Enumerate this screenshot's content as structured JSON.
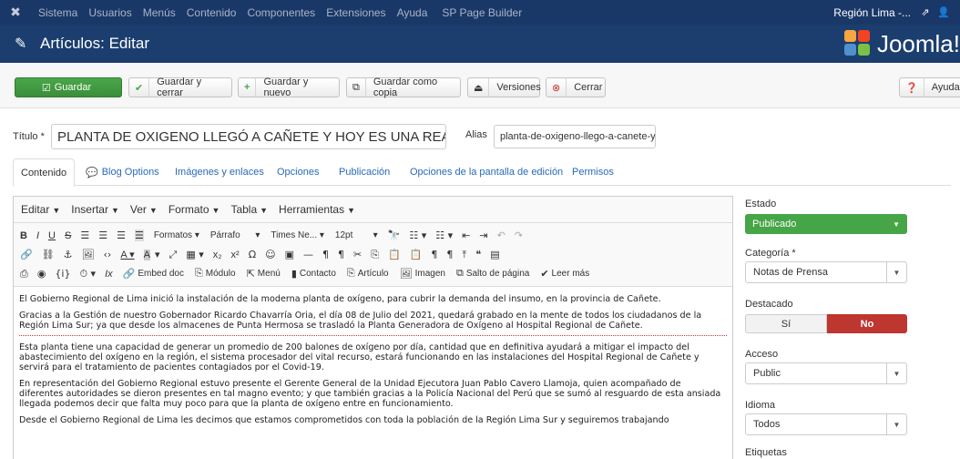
{
  "topnav": {
    "menu": [
      "Sistema",
      "Usuarios",
      "Menús",
      "Contenido",
      "Componentes",
      "Extensiones",
      "Ayuda",
      "SP Page Builder"
    ],
    "site_label": "Región Lima -...",
    "external_icon": "external-link-icon",
    "user_icon": "user-icon"
  },
  "titlebar": {
    "title": "Artículos: Editar",
    "brand": "Joomla!"
  },
  "toolbar": {
    "save": "Guardar",
    "save_close": "Guardar y cerrar",
    "save_new": "Guardar y nuevo",
    "save_copy": "Guardar como copia",
    "versions": "Versiones",
    "close": "Cerrar",
    "help": "Ayuda"
  },
  "form": {
    "title_label": "Título *",
    "title_value": "PLANTA DE OXIGENO LLEGÓ A CAÑETE Y HOY ES UNA REALI",
    "alias_label": "Alias",
    "alias_value": "planta-de-oxigeno-llego-a-canete-y-"
  },
  "tabs": [
    "Contenido",
    "Blog Options",
    "Imágenes y enlaces",
    "Opciones",
    "Publicación",
    "Opciones de la pantalla de edición",
    "Permisos"
  ],
  "editor": {
    "menubar": [
      "Editar",
      "Insertar",
      "Ver",
      "Formato",
      "Tabla",
      "Herramientas"
    ],
    "formats": "Formatos",
    "block": "Párrafo",
    "font": "Times Ne...",
    "size": "12pt",
    "plugins": {
      "embed": "Embed doc",
      "module": "Módulo",
      "menu": "Menú",
      "contact": "Contacto",
      "article": "Artículo",
      "image": "Imagen",
      "pagebreak": "Salto de página",
      "readmore": "Leer más"
    },
    "paragraphs": {
      "p1": "El Gobierno Regional de Lima inició la instalación de la moderna planta de oxígeno, para cubrir la demanda del insumo, en la provincia de Cañete.",
      "p2": "Gracias a la Gestión de nuestro Gobernador Ricardo Chavarría Oria, el día 08 de Julio del 2021, quedará grabado en la mente de todos los ciudadanos de la Región Lima Sur; ya que desde los almacenes de Punta Hermosa se trasladó la Planta Generadora de Oxígeno al Hospital Regional de Cañete.",
      "p3": "Esta planta tiene una capacidad de generar un promedio de 200 balones de oxígeno por día, cantidad que en definitiva ayudará a mitigar el impacto del abastecimiento del oxígeno en la región, el sistema procesador del vital recurso, estará funcionando en las instalaciones del Hospital Regional de Cañete y servirá para el tratamiento de pacientes contagiados por el Covid-19.",
      "p4": "En representación del Gobierno Regional estuvo presente el Gerente General de la Unidad Ejecutora Juan Pablo Cavero Llamoja, quien acompañado de diferentes autoridades se dieron presentes en tal magno evento; y que también gracias a la Policía Nacional del Perú que se sumó al resguardo de esta ansiada llegada podemos decir que falta muy poco para que la planta de oxígeno entre en funcionamiento.",
      "p5": "Desde el Gobierno Regional de Lima les decimos que estamos comprometidos con toda la población de la Región Lima Sur y seguiremos trabajando"
    }
  },
  "sidebar": {
    "estado_label": "Estado",
    "estado_value": "Publicado",
    "categoria_label": "Categoría *",
    "categoria_value": "Notas de Prensa",
    "destacado_label": "Destacado",
    "destacado_si": "Sí",
    "destacado_no": "No",
    "acceso_label": "Acceso",
    "acceso_value": "Public",
    "idioma_label": "Idioma",
    "idioma_value": "Todos",
    "etiquetas_label": "Etiquetas"
  },
  "colors": {
    "topnav": "#1a3867",
    "titlebar": "#1b3e6f",
    "save_green": "#46a546",
    "no_red": "#bd362f"
  }
}
